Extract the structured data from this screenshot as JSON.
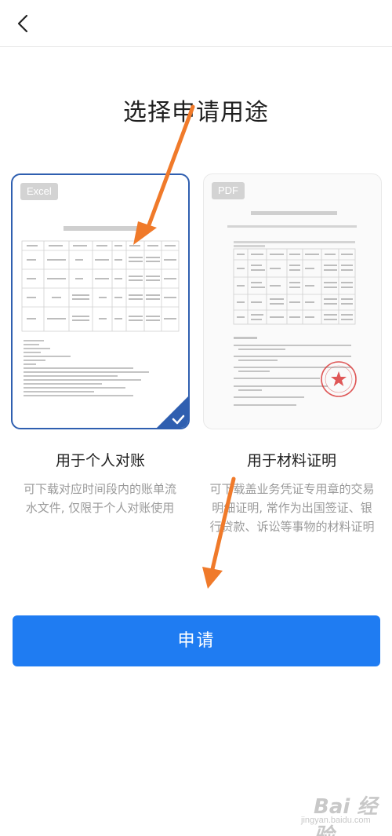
{
  "nav": {
    "back_icon": "chevron-left-icon"
  },
  "page": {
    "title": "选择申请用途"
  },
  "options": [
    {
      "format_badge": "Excel",
      "title": "用于个人对账",
      "description": "可下载对应时间段内的账单流水文件, 仅限于个人对账使用",
      "selected": true
    },
    {
      "format_badge": "PDF",
      "title": "用于材料证明",
      "description": "可下载盖业务凭证专用章的交易明细证明, 常作为出国签证、银行贷款、诉讼等事物的材料证明",
      "selected": false
    }
  ],
  "apply_button": {
    "label": "申请"
  },
  "watermark": {
    "text": "Bai 经验",
    "sub": "jingyan.baidu.com"
  },
  "colors": {
    "primary": "#1f7cf2",
    "selected_border": "#2f5fb0",
    "arrow": "#f07a2a",
    "stamp": "#d93a3a",
    "muted_text": "#9a9a9a"
  }
}
